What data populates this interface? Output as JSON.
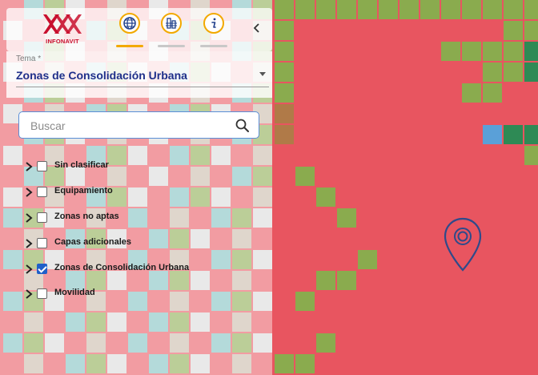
{
  "app": {
    "logo_text": "INFONAVIT",
    "brand_color": "#c8102e",
    "accent_color": "#f2a900"
  },
  "toolbar": {
    "tools": [
      {
        "icon": "globe-layers-icon",
        "active": true
      },
      {
        "icon": "city-grid-icon",
        "active": false
      },
      {
        "icon": "info-icon",
        "active": false
      }
    ],
    "collapse_icon": "chevron-left-icon"
  },
  "tema": {
    "label": "Tema *",
    "value": "Zonas de Consolidación Urbana"
  },
  "search": {
    "placeholder": "Buscar"
  },
  "layers": [
    {
      "label": "Sin clasificar",
      "checked": false
    },
    {
      "label": "Equipamiento",
      "checked": false
    },
    {
      "label": "Zonas no aptas",
      "checked": false
    },
    {
      "label": "Capas adicionales",
      "checked": false
    },
    {
      "label": "Zonas de Consolidación Urbana",
      "checked": true
    },
    {
      "label": "Movilidad",
      "checked": false
    }
  ],
  "map": {
    "colors": {
      "red": "#e85560",
      "olive": "#8aab4e",
      "dark_green": "#2e8a55",
      "blue": "#5aa0d8",
      "brown": "#b07a48",
      "teal": "#7fbfbf"
    }
  }
}
